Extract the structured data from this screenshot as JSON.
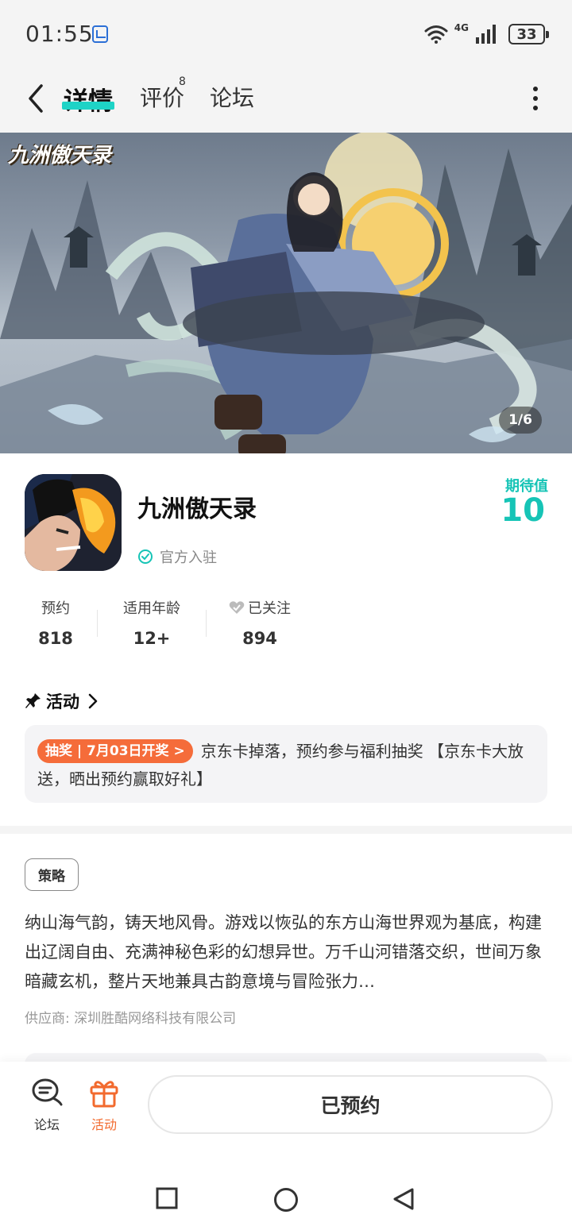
{
  "status_bar": {
    "time": "01:55",
    "network": "4G",
    "battery": "33",
    "icons": [
      "app-notification-icon",
      "wifi-icon",
      "signal-icon",
      "battery-icon"
    ]
  },
  "nav": {
    "tabs": [
      {
        "label": "详情",
        "active": true
      },
      {
        "label": "评价",
        "count": "8"
      },
      {
        "label": "论坛"
      }
    ],
    "icons": [
      "back-icon",
      "more-icon"
    ]
  },
  "hero": {
    "logo_text": "九洲傲天录",
    "counter": "1/6"
  },
  "app": {
    "name": "九洲傲天录",
    "verified_label": "官方入驻",
    "expect_label": "期待值",
    "expect_value": "10"
  },
  "stats": [
    {
      "label": "预约",
      "value": "818"
    },
    {
      "label": "适用年龄",
      "value": "12+"
    },
    {
      "label": "已关注",
      "value": "894"
    }
  ],
  "activity": {
    "header": "活动",
    "badge": "抽奖 | 7月03日开奖 >",
    "text": "京东卡掉落，预约参与福利抽奖 【京东卡大放送，晒出预约赢取好礼】"
  },
  "strategy": {
    "tag": "策略",
    "description": "纳山海气韵，铸天地风骨。游戏以恢弘的东方山海世界观为基底，构建出辽阔自由、充满神秘色彩的幻想异世。万千山河错落交织，世间万象暗藏玄机，整片天地兼具古韵意境与冒险张力…",
    "supplier": "供应商:  深圳胜酷网络科技有限公司"
  },
  "bottom": {
    "forum_label": "论坛",
    "activity_label": "活动",
    "reserve_label": "已预约"
  },
  "colors": {
    "accent": "#16c4b6",
    "activity_orange": "#f56c3a",
    "text_primary": "#222222",
    "text_muted": "#999999"
  }
}
